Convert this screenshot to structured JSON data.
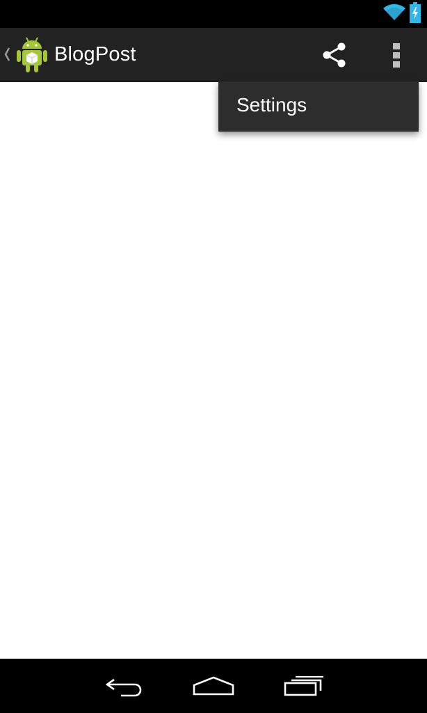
{
  "status_bar": {
    "icons": [
      "wifi-icon",
      "battery-charging-icon"
    ],
    "accent_color": "#33b5e5"
  },
  "action_bar": {
    "title": "BlogPost",
    "background_color": "#222222",
    "icons": [
      "up-caret-icon",
      "android-logo-icon",
      "share-icon",
      "overflow-menu-icon"
    ]
  },
  "overflow_menu": {
    "items": [
      {
        "label": "Settings"
      }
    ]
  },
  "nav_bar": {
    "icons": [
      "back-icon",
      "home-icon",
      "recent-apps-icon"
    ]
  }
}
